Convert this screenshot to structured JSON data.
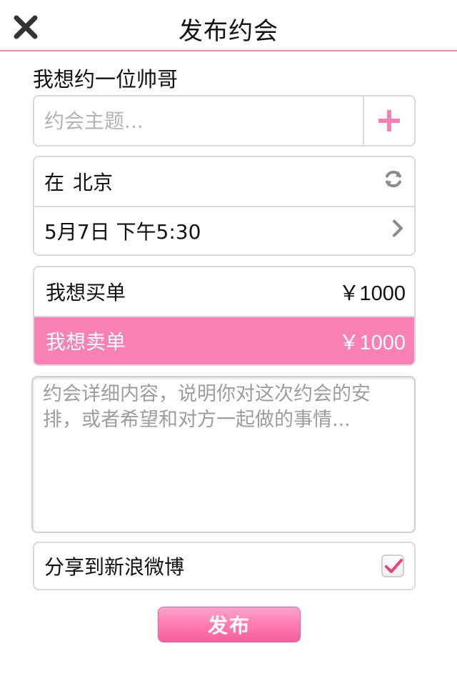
{
  "header": {
    "title": "发布约会",
    "close_icon": "close-icon"
  },
  "intent_label": "我想约一位帅哥",
  "topic": {
    "placeholder": "约会主题...",
    "value": "",
    "add_icon": "plus-icon"
  },
  "location": {
    "prefix": "在",
    "city": "北京",
    "icon": "refresh-icon"
  },
  "time": {
    "text": "5月7日 下午5:30",
    "icon": "chevron-right-icon"
  },
  "payment": {
    "options": [
      {
        "label": "我想买单",
        "price": "￥1000",
        "selected": false
      },
      {
        "label": "我想卖单",
        "price": "￥1000",
        "selected": true
      }
    ]
  },
  "details": {
    "placeholder": "约会详细内容，说明你对这次约会的安排，或者希望和对方一起做的事情..."
  },
  "share": {
    "label": "分享到新浪微博",
    "checked": true
  },
  "publish_button": "发布",
  "colors": {
    "accent": "#f980b5",
    "divider": "#f07fb1",
    "border": "#d9d9d9",
    "placeholder": "#b3b3b3"
  }
}
